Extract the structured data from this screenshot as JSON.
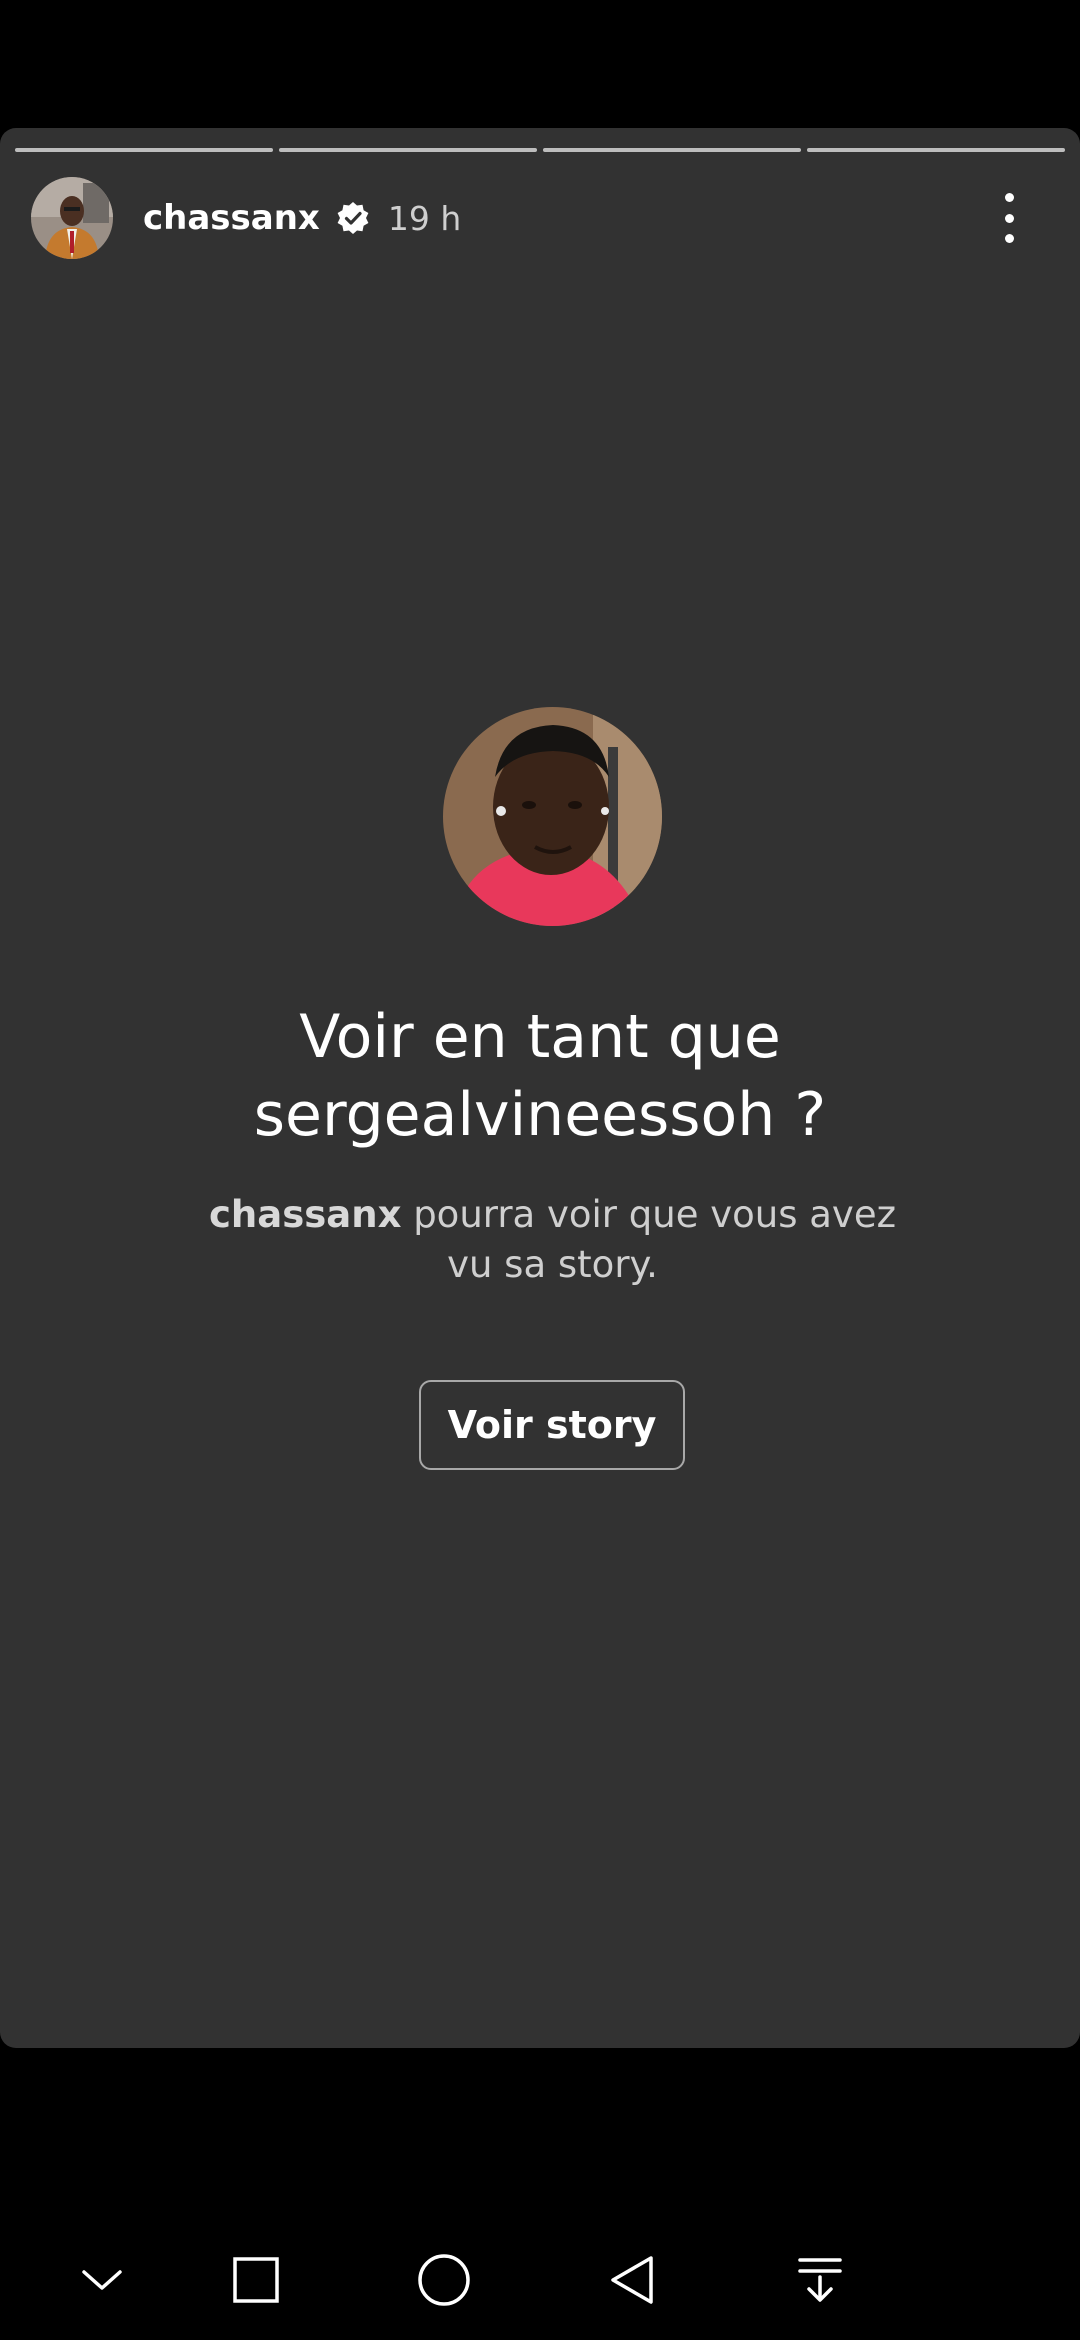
{
  "story": {
    "username": "chassanx",
    "time": "19 h",
    "progress_segments": 4,
    "verified_icon": "verified-badge-icon",
    "more_icon": "more-vertical-icon"
  },
  "prompt": {
    "title_line1": "Voir en tant que",
    "title_line2": "sergealvineessoh ?",
    "subtitle_username": "chassanx",
    "subtitle_rest_line1": " pourra voir que vous avez",
    "subtitle_line2": "vu sa story.",
    "button_label": "Voir story"
  },
  "navbar": {
    "icons": [
      "chevron-down-icon",
      "recent-apps-square-icon",
      "home-circle-icon",
      "back-triangle-icon",
      "notification-pulldown-icon"
    ]
  },
  "colors": {
    "background": "#000000",
    "card": "#323232",
    "text_primary": "#ffffff",
    "text_secondary": "#cfcfcf"
  }
}
